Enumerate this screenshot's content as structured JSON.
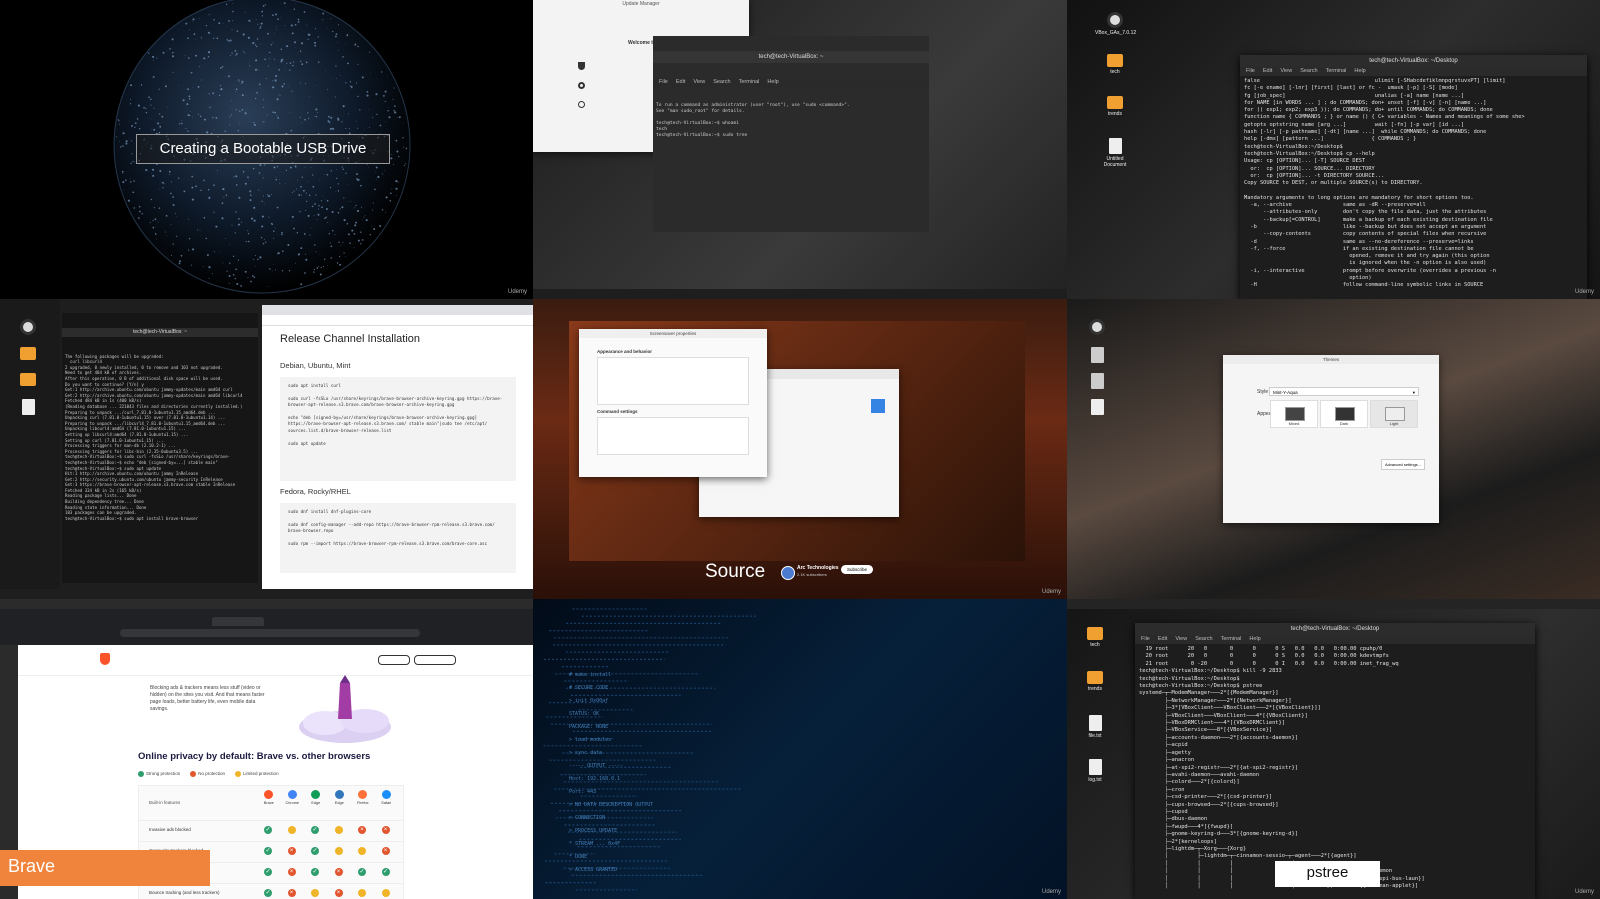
{
  "cells": {
    "earth": {
      "caption": "Creating a Bootable USB Drive",
      "watermark": "Udemy"
    },
    "update_manager": {
      "window_title": "Update Manager",
      "welcome": "Welcome to the Upda",
      "terminal_title": "tech@tech-VirtualBox: ~",
      "terminal_lines": [
        "To run a command as administrator (user \"root\"), use \"sudo <command>\".",
        "See \"man sudo_root\" for details.",
        "",
        "tech@tech-VirtualBox:~$ whoami",
        "tech",
        "tech@tech-VirtualBox:~$ sudo tree"
      ]
    },
    "cp_help": {
      "desktop_icons": [
        {
          "kind": "disc",
          "label": "VBox_GAs_7.0.12"
        },
        {
          "kind": "folder",
          "label": "tech"
        },
        {
          "kind": "folder",
          "label": "trends"
        },
        {
          "kind": "file",
          "label": "Untitled Document"
        }
      ],
      "window_title": "tech@tech-VirtualBox: ~/Desktop",
      "menu": [
        "File",
        "Edit",
        "View",
        "Search",
        "Terminal",
        "Help"
      ],
      "lines": [
        "false                                    ulimit [-SHabcdefiklmnpqrstuvxPT] [limit]",
        "fc [-e ename] [-lnr] [first] [last] or fc -  umask [-p] [-S] [mode]",
        "fg [job_spec]                            unalias [-a] name [name ...]",
        "for NAME [in WORDS ... ] ; do COMMANDS; don+ unset [-f] [-v] [-n] [name ...]",
        "for (( exp1; exp2; exp3 )); do COMMANDS; do+ until COMMANDS; do COMMANDS; done",
        "function name { COMMANDS ; } or name () { C+ variables - Names and meanings of some she>",
        "getopts optstring name [arg ...]         wait [-fn] [-p var] [id ...]",
        "hash [-lr] [-p pathname] [-dt] [name ...]  while COMMANDS; do COMMANDS; done",
        "help [-dms] [pattern ...]               { COMMANDS ; }",
        "tech@tech-VirtualBox:~/Desktop$",
        "tech@tech-VirtualBox:~/Desktop$ cp --help",
        "Usage: cp [OPTION]... [-T] SOURCE DEST",
        "  or:  cp [OPTION]... SOURCE... DIRECTORY",
        "  or:  cp [OPTION]... -t DIRECTORY SOURCE...",
        "Copy SOURCE to DEST, or multiple SOURCE(s) to DIRECTORY.",
        "",
        "Mandatory arguments to long options are mandatory for short options too.",
        "  -a, --archive                same as -dR --preserve=all",
        "      --attributes-only        don't copy the file data, just the attributes",
        "      --backup[=CONTROL]       make a backup of each existing destination file",
        "  -b                           like --backup but does not accept an argument",
        "      --copy-contents          copy contents of special files when recursive",
        "  -d                           same as --no-dereference --preserve=links",
        "  -f, --force                  if an existing destination file cannot be",
        "                                 opened, remove it and try again (this option",
        "                                 is ignored when the -n option is also used)",
        "  -i, --interactive            prompt before overwrite (overrides a previous -n",
        "                                 option)",
        "  -H                           follow command-line symbolic links in SOURCE"
      ]
    },
    "release_channel": {
      "heading": "Release Channel Installation",
      "os1": "Debian, Ubuntu, Mint",
      "code1": [
        "sudo apt install curl",
        "",
        "sudo curl -fsSLo /usr/share/keyrings/brave-browser-archive-keyring.gpg https://brave-",
        "browser-apt-release.s3.brave.com/brave-browser-archive-keyring.gpg",
        "",
        "echo \"deb [signed-by=/usr/share/keyrings/brave-browser-archive-keyring.gpg] https://brave-browser-apt-release.s3.brave.com/ stable main\"|sudo tee /etc/apt/",
        "sources.list.d/brave-browser-release.list",
        "",
        "sudo apt update"
      ],
      "os2": "Fedora, Rocky/RHEL",
      "code2": [
        "sudo dnf install dnf-plugins-core",
        "",
        "sudo dnf config-manager --add-repo https://brave-browser-rpm-release.s3.brave.com/",
        "brave-browser.repo",
        "",
        "sudo rpm --import https://brave-browser-rpm-release.s3.brave.com/brave-core.asc"
      ],
      "term_lines": [
        "The following packages will be upgraded:",
        "  curl libcurl4",
        "2 upgraded, 0 newly installed, 0 to remove and 103 not upgraded.",
        "Need to get 484 kB of archives.",
        "After this operation, 0 B of additional disk space will be used.",
        "Do you want to continue? [Y/n] y",
        "Get:1 http://archive.ubuntu.com/ubuntu jammy-updates/main amd64 curl",
        "Get:2 http://archive.ubuntu.com/ubuntu jammy-updates/main amd64 libcurl4",
        "Fetched 484 kB in 1s (400 kB/s)",
        "(Reading database ... 221043 files and directories currently installed.)",
        "Preparing to unpack .../curl_7.81.0-1ubuntu1.15_amd64.deb ...",
        "Unpacking curl (7.81.0-1ubuntu1.15) over (7.81.0-1ubuntu1.14) ...",
        "Preparing to unpack .../libcurl4_7.81.0-1ubuntu1.15_amd64.deb ...",
        "Unpacking libcurl4:amd64 (7.81.0-1ubuntu1.15) ...",
        "Setting up libcurl4:amd64 (7.81.0-1ubuntu1.15) ...",
        "Setting up curl (7.81.0-1ubuntu1.15) ...",
        "Processing triggers for man-db (2.10.2-1) ...",
        "Processing triggers for libc-bin (2.35-0ubuntu3.5) ...",
        "tech@tech-VirtualBox:~$ sudo curl -fsSLo /usr/share/keyrings/brave-",
        "tech@tech-VirtualBox:~$ echo \"deb [signed-by=...] stable main\"",
        "tech@tech-VirtualBox:~$ sudo apt update",
        "Hit:1 http://archive.ubuntu.com/ubuntu jammy InRelease",
        "Get:2 http://security.ubuntu.com/ubuntu jammy-security InRelease",
        "Get:3 https://brave-browser-apt-release.s3.brave.com stable InRelease",
        "Fetched 334 kB in 2s (165 kB/s)",
        "Reading package lists... Done",
        "Building dependency tree... Done",
        "Reading state information... Done",
        "103 packages can be upgraded.",
        "tech@tech-VirtualBox:~$ sudo apt install brave-browser"
      ]
    },
    "source_video": {
      "source": "Source",
      "channel": "Arc Technologies",
      "subscribers": "2.1K subscribers",
      "subscribe": "Subscribe",
      "dialog_title": "Screensaver properties",
      "section1": "Appearance and behavior",
      "section2": "Command settings"
    },
    "themes": {
      "window_title": "Themes",
      "style_label": "Style",
      "style_value": "Mint-Y-Aqua",
      "appearance_label": "Appearance",
      "options": [
        "Mixed",
        "Dark",
        "Light"
      ],
      "advanced": "Advanced settings..."
    },
    "brave": {
      "privacy_heading": "Online privacy by default: Brave vs. other browsers",
      "legend": [
        "Strong protection",
        "No protection",
        "Limited protection"
      ],
      "intro": "Blocking ads & trackers means less stuff (video or hidden) on the sites you visit. And that means faster page loads, better battery life, even mobile data savings.",
      "features_label": "Built-in features",
      "browsers": [
        "Brave",
        "Chrome",
        "Edge",
        "Edge",
        "Firefox",
        "Safari"
      ],
      "rows": [
        {
          "label": "Invasive ads blocked",
          "marks": [
            "g",
            "y",
            "g",
            "y",
            "r",
            "r"
          ]
        },
        {
          "label": "Cross-site trackers blocked",
          "marks": [
            "g",
            "r",
            "g",
            "y",
            "y",
            "r"
          ]
        },
        {
          "label": "Fingerprinting blocked",
          "marks": [
            "g",
            "r",
            "g",
            "r",
            "g",
            "g"
          ]
        },
        {
          "label": "Bounce tracking (and less trackers)",
          "marks": [
            "g",
            "r",
            "y",
            "r",
            "y",
            "y"
          ]
        }
      ],
      "badge": "Brave"
    },
    "code_scroll": {
      "lines": [
        "  # make install",
        "  # SECURE CODE",
        "  > init 0x00af",
        "  STATUS: OK",
        "  PACKAGE: NONE",
        "  > load modules",
        "  > sync data",
        "  ----- OUTPUT -----",
        "  Host: 192.168.0.1",
        "  Port: 443",
        "  > NO DATA DESCRIPTION OUTPUT",
        "  > CONNECTION",
        "  > PROCESS UPDATE",
        "  * STREAM ... 0x4F",
        "  * DONE",
        "  > ACCESS GRANTED"
      ]
    },
    "pstree": {
      "desktop_icons": [
        {
          "kind": "folder",
          "label": "tech"
        },
        {
          "kind": "folder",
          "label": "trends"
        },
        {
          "kind": "file",
          "label": "file.txt"
        },
        {
          "kind": "file",
          "label": "log.txt"
        }
      ],
      "window_title": "tech@tech-VirtualBox: ~/Desktop",
      "menu": [
        "File",
        "Edit",
        "View",
        "Search",
        "Terminal",
        "Help"
      ],
      "lines": [
        "  19 root      20   0       0      0      0 S   0.0   0.0   0:00.00 cpuhp/0",
        "  20 root      20   0       0      0      0 S   0.0   0.0   0:00.00 kdevtmpfs",
        "  21 root       0 -20       0      0      0 I   0.0   0.0   0:00.00 inet_frag_wq",
        "tech@tech-VirtualBox:~/Desktop$ kill -9 2833",
        "tech@tech-VirtualBox:~/Desktop$",
        "tech@tech-VirtualBox:~/Desktop$ pstree",
        "systemd─┬─ModemManager───2*[{ModemManager}]",
        "        ├─NetworkManager───2*[{NetworkManager}]",
        "        ├─3*[VBoxClient───VBoxClient───2*[{VBoxClient}]]",
        "        ├─VBoxClient───VBoxClient───4*[{VBoxClient}]",
        "        ├─VBoxDRMClient───4*[{VBoxDRMClient}]",
        "        ├─VBoxService───8*[{VBoxService}]",
        "        ├─accounts-daemon───2*[{accounts-daemon}]",
        "        ├─acpid",
        "        ├─agetty",
        "        ├─anacron",
        "        ├─at-spi2-registr───2*[{at-spi2-registr}]",
        "        ├─avahi-daemon───avahi-daemon",
        "        ├─colord───2*[{colord}]",
        "        ├─cron",
        "        ├─csd-printer───2*[{csd-printer}]",
        "        ├─cups-browsed───2*[{cups-browsed}]",
        "        ├─cupsd",
        "        ├─dbus-daemon",
        "        ├─fwupd───4*[{fwupd}]",
        "        ├─gnome-keyring-d───3*[{gnome-keyring-d}]",
        "        ├─2*[kerneloops]",
        "        ├─lightdm─┬─Xorg───{Xorg}",
        "        │         ├─lightdm─┬─cinnamon-sessio─┬─agent───2*[{agent}]",
        "        │         │         │                  ├─applet.py",
        "        │         │         │                  ├─at-spi-bus-laun─┬─dbus-daemon",
        "        │         │         │                  │                 └─4*[{at-spi-bus-laun}]",
        "        │         │         │                  ├─blueman-applet───2*[{blueman-applet}]"
      ],
      "badge": "pstree"
    }
  },
  "colors": {
    "accent_orange": "#f0843c",
    "mint_green": "#4e9a3a",
    "terminal_bg": "#1d1d1d",
    "brave_orange": "#fb542b"
  }
}
